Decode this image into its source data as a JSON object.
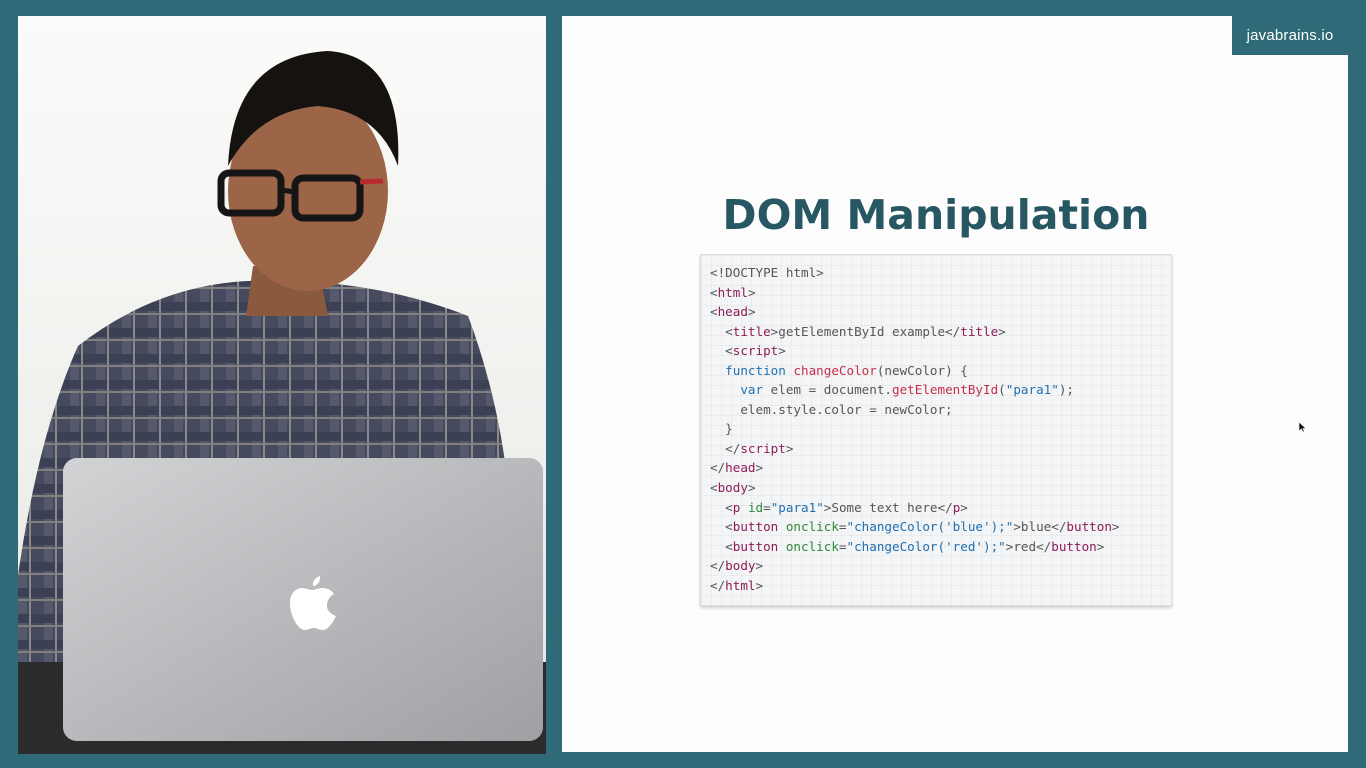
{
  "brand": {
    "label": "javabrains.io"
  },
  "slide": {
    "title": "DOM Manipulation",
    "code_lines": [
      [
        {
          "t": "<!DOCTYPE html>",
          "c": "c-punct"
        }
      ],
      [
        {
          "t": "<",
          "c": "c-punct"
        },
        {
          "t": "html",
          "c": "c-tag"
        },
        {
          "t": ">",
          "c": "c-punct"
        }
      ],
      [
        {
          "t": "<",
          "c": "c-punct"
        },
        {
          "t": "head",
          "c": "c-tag"
        },
        {
          "t": ">",
          "c": "c-punct"
        }
      ],
      [
        {
          "t": "  <",
          "c": "c-punct"
        },
        {
          "t": "title",
          "c": "c-tag"
        },
        {
          "t": ">getElementById example</",
          "c": "c-punct"
        },
        {
          "t": "title",
          "c": "c-tag"
        },
        {
          "t": ">",
          "c": "c-punct"
        }
      ],
      [
        {
          "t": "  <",
          "c": "c-punct"
        },
        {
          "t": "script",
          "c": "c-tag"
        },
        {
          "t": ">",
          "c": "c-punct"
        }
      ],
      [
        {
          "t": "  ",
          "c": "c-punct"
        },
        {
          "t": "function",
          "c": "c-kw"
        },
        {
          "t": " ",
          "c": "c-punct"
        },
        {
          "t": "changeColor",
          "c": "c-fn"
        },
        {
          "t": "(newColor) {",
          "c": "c-punct"
        }
      ],
      [
        {
          "t": "    ",
          "c": "c-punct"
        },
        {
          "t": "var",
          "c": "c-kw"
        },
        {
          "t": " elem = document.",
          "c": "c-punct"
        },
        {
          "t": "getElementById",
          "c": "c-fn"
        },
        {
          "t": "(",
          "c": "c-punct"
        },
        {
          "t": "\"para1\"",
          "c": "c-str"
        },
        {
          "t": ");",
          "c": "c-punct"
        }
      ],
      [
        {
          "t": "    elem.style.color = newColor;",
          "c": "c-punct"
        }
      ],
      [
        {
          "t": "  }",
          "c": "c-punct"
        }
      ],
      [
        {
          "t": "  </",
          "c": "c-punct"
        },
        {
          "t": "script",
          "c": "c-tag"
        },
        {
          "t": ">",
          "c": "c-punct"
        }
      ],
      [
        {
          "t": "</",
          "c": "c-punct"
        },
        {
          "t": "head",
          "c": "c-tag"
        },
        {
          "t": ">",
          "c": "c-punct"
        }
      ],
      [
        {
          "t": "<",
          "c": "c-punct"
        },
        {
          "t": "body",
          "c": "c-tag"
        },
        {
          "t": ">",
          "c": "c-punct"
        }
      ],
      [
        {
          "t": "  <",
          "c": "c-punct"
        },
        {
          "t": "p",
          "c": "c-tag"
        },
        {
          "t": " ",
          "c": "c-punct"
        },
        {
          "t": "id",
          "c": "c-attr"
        },
        {
          "t": "=",
          "c": "c-punct"
        },
        {
          "t": "\"para1\"",
          "c": "c-str"
        },
        {
          "t": ">Some text here</",
          "c": "c-punct"
        },
        {
          "t": "p",
          "c": "c-tag"
        },
        {
          "t": ">",
          "c": "c-punct"
        }
      ],
      [
        {
          "t": "  <",
          "c": "c-punct"
        },
        {
          "t": "button",
          "c": "c-tag"
        },
        {
          "t": " ",
          "c": "c-punct"
        },
        {
          "t": "onclick",
          "c": "c-attr"
        },
        {
          "t": "=",
          "c": "c-punct"
        },
        {
          "t": "\"changeColor('blue');\"",
          "c": "c-str"
        },
        {
          "t": ">blue</",
          "c": "c-punct"
        },
        {
          "t": "button",
          "c": "c-tag"
        },
        {
          "t": ">",
          "c": "c-punct"
        }
      ],
      [
        {
          "t": "  <",
          "c": "c-punct"
        },
        {
          "t": "button",
          "c": "c-tag"
        },
        {
          "t": " ",
          "c": "c-punct"
        },
        {
          "t": "onclick",
          "c": "c-attr"
        },
        {
          "t": "=",
          "c": "c-punct"
        },
        {
          "t": "\"changeColor('red');\"",
          "c": "c-str"
        },
        {
          "t": ">red</",
          "c": "c-punct"
        },
        {
          "t": "button",
          "c": "c-tag"
        },
        {
          "t": ">",
          "c": "c-punct"
        }
      ],
      [
        {
          "t": "</",
          "c": "c-punct"
        },
        {
          "t": "body",
          "c": "c-tag"
        },
        {
          "t": ">",
          "c": "c-punct"
        }
      ],
      [
        {
          "t": "</",
          "c": "c-punct"
        },
        {
          "t": "html",
          "c": "c-tag"
        },
        {
          "t": ">",
          "c": "c-punct"
        }
      ]
    ]
  },
  "colors": {
    "frame": "#2e6a77",
    "title": "#265763",
    "tag": "#8d1c57",
    "keyword": "#1f6fb0",
    "function": "#c72d4b",
    "attribute": "#2f8a3a"
  },
  "icons": {
    "laptop_logo": "apple-logo-icon",
    "cursor": "mouse-pointer-icon"
  }
}
